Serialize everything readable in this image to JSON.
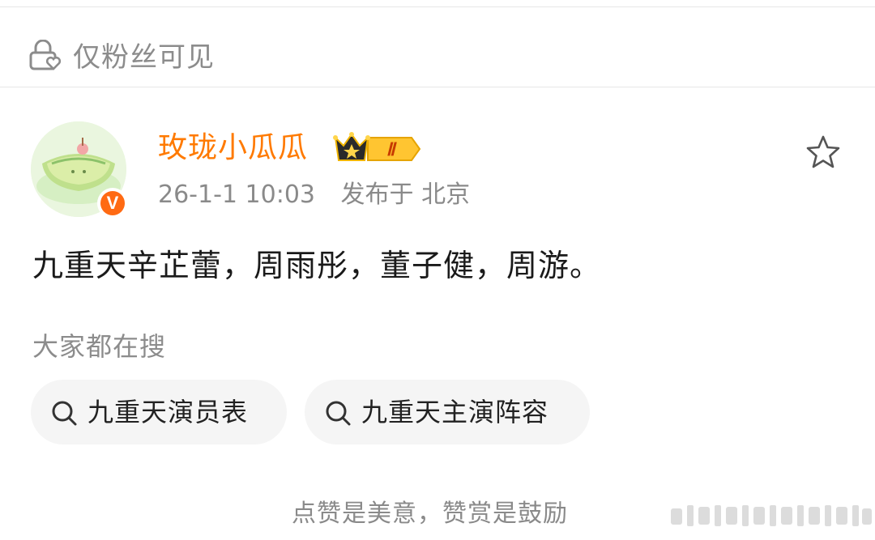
{
  "visibility": {
    "label": "仅粉丝可见",
    "icon": "lock-heart-icon"
  },
  "author": {
    "name": "玫珑小瓜瓜",
    "level_badge": "Ⅱ",
    "verified_badge": "V",
    "timestamp": "26-1-1 10:03",
    "location": "发布于 北京"
  },
  "post": {
    "text": "九重天辛芷蕾，周雨彤，董子健，周游。"
  },
  "hot_search": {
    "title": "大家都在搜",
    "chips": [
      {
        "label": "九重天演员表",
        "icon": "search-icon"
      },
      {
        "label": "九重天主演阵容",
        "icon": "search-icon"
      }
    ]
  },
  "footer": {
    "reward_note": "点赞是美意，赞赏是鼓励"
  },
  "colors": {
    "accent": "#ff7a00",
    "muted": "#8c8c8c",
    "chip_bg": "#f5f5f5",
    "badge": "#ff6a13"
  }
}
